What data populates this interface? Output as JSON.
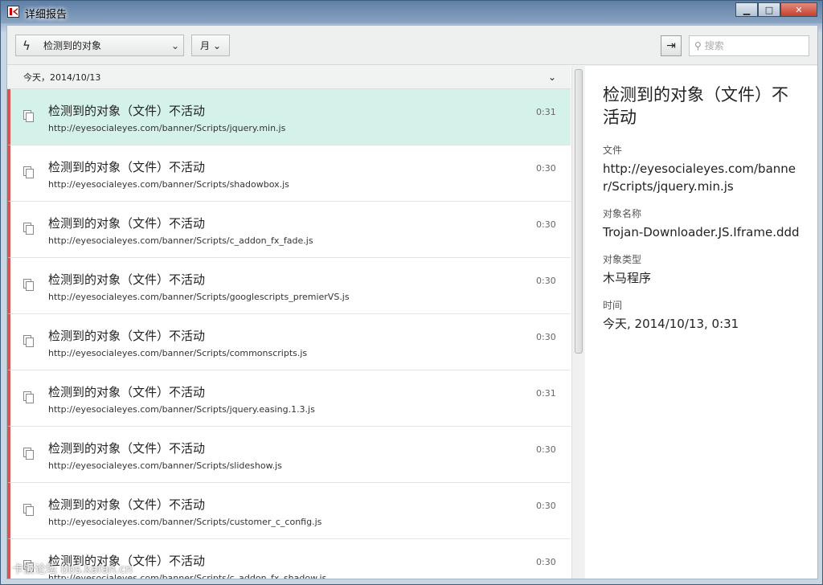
{
  "window": {
    "title": "详细报告"
  },
  "toolbar": {
    "filter_label": "检测到的对象",
    "period_label": "月",
    "search_placeholder": "搜索"
  },
  "list": {
    "date_header": "今天，2014/10/13",
    "rows": [
      {
        "title": "检测到的对象（文件）不活动",
        "url": "http://eyesocialeyes.com/banner/Scripts/jquery.min.js",
        "time": "0:31"
      },
      {
        "title": "检测到的对象（文件）不活动",
        "url": "http://eyesocialeyes.com/banner/Scripts/shadowbox.js",
        "time": "0:30"
      },
      {
        "title": "检测到的对象（文件）不活动",
        "url": "http://eyesocialeyes.com/banner/Scripts/c_addon_fx_fade.js",
        "time": "0:30"
      },
      {
        "title": "检测到的对象（文件）不活动",
        "url": "http://eyesocialeyes.com/banner/Scripts/googlescripts_premierVS.js",
        "time": "0:30"
      },
      {
        "title": "检测到的对象（文件）不活动",
        "url": "http://eyesocialeyes.com/banner/Scripts/commonscripts.js",
        "time": "0:30"
      },
      {
        "title": "检测到的对象（文件）不活动",
        "url": "http://eyesocialeyes.com/banner/Scripts/jquery.easing.1.3.js",
        "time": "0:31"
      },
      {
        "title": "检测到的对象（文件）不活动",
        "url": "http://eyesocialeyes.com/banner/Scripts/slideshow.js",
        "time": "0:30"
      },
      {
        "title": "检测到的对象（文件）不活动",
        "url": "http://eyesocialeyes.com/banner/Scripts/customer_c_config.js",
        "time": "0:30"
      },
      {
        "title": "检测到的对象（文件）不活动",
        "url": "http://eyesocialeyes.com/banner/Scripts/c_addon_fx_shadow.js",
        "time": "0:30"
      }
    ]
  },
  "detail": {
    "title": "检测到的对象（文件）不活动",
    "file_label": "文件",
    "file_value": "http://eyesocialeyes.com/banner/Scripts/jquery.min.js",
    "name_label": "对象名称",
    "name_value": "Trojan-Downloader.JS.Iframe.ddd",
    "type_label": "对象类型",
    "type_value": "木马程序",
    "time_label": "时间",
    "time_value": "今天, 2014/10/13, 0:31"
  },
  "watermark": "卡饭论坛 bbs.kafan.cn",
  "colors": {
    "selected_row": "#d5f2ea",
    "threat_marker": "#d9534f"
  }
}
